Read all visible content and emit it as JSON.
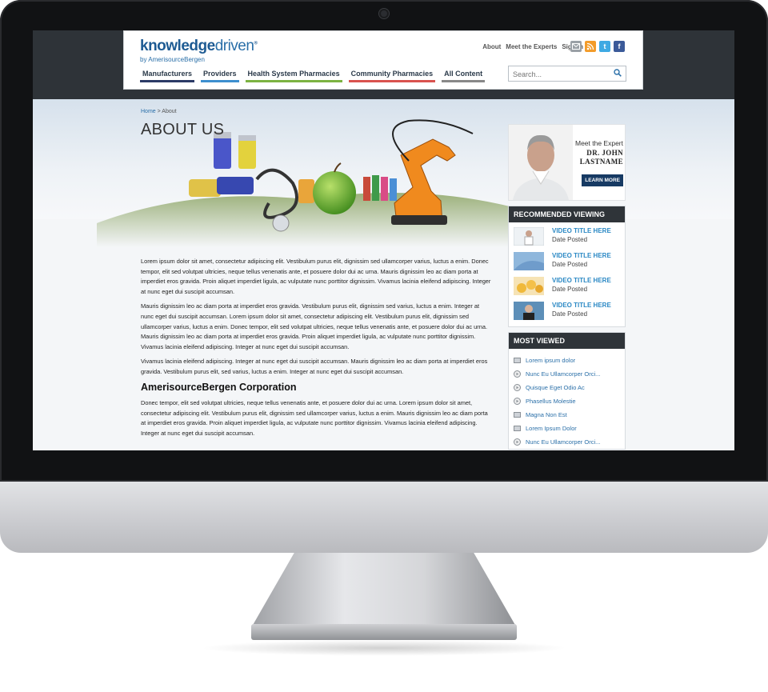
{
  "site": {
    "logo_main": "knowledge",
    "logo_main_thin": "driven",
    "logo_sub": "by AmerisourceBergen",
    "top_links": [
      "About",
      "Meet the Experts",
      "Sign In"
    ],
    "social_icons": [
      "mail-icon",
      "rss-icon",
      "twitter-icon",
      "facebook-icon"
    ],
    "nav": [
      {
        "label": "Manufacturers",
        "color": "#2b3a66"
      },
      {
        "label": "Providers",
        "color": "#3d8fcf"
      },
      {
        "label": "Health System Pharmacies",
        "color": "#7cb342"
      },
      {
        "label": "Community Pharmacies",
        "color": "#d9534f"
      },
      {
        "label": "All Content",
        "color": "#888888"
      }
    ],
    "search_placeholder": "Search..."
  },
  "breadcrumb": {
    "home": "Home",
    "separator": " > ",
    "current": "About"
  },
  "page_title": "ABOUT US",
  "paragraphs": [
    "Lorem ipsum dolor sit amet, consectetur adipiscing elit. Vestibulum purus elit, dignissim sed ullamcorper varius, luctus a enim. Donec tempor, elit sed volutpat ultricies, neque tellus venenatis ante, et posuere dolor dui ac urna. Mauris dignissim leo ac diam porta at imperdiet eros gravida. Proin aliquet imperdiet ligula, ac vulputate nunc porttitor dignissim. Vivamus lacinia eleifend adipiscing. Integer at nunc eget dui suscipit accumsan.",
    "Mauris dignissim leo ac diam porta at imperdiet eros gravida. Vestibulum purus elit, dignissim sed varius, luctus a enim. Integer at nunc eget dui suscipit accumsan. Lorem ipsum dolor sit amet, consectetur adipiscing elit. Vestibulum purus elit, dignissim sed ullamcorper varius, luctus a enim. Donec tempor, elit sed volutpat ultricies, neque tellus venenatis ante, et posuere dolor dui ac urna. Mauris dignissim leo ac diam porta at imperdiet eros gravida. Proin aliquet imperdiet ligula, ac vulputate nunc porttitor dignissim. Vivamus lacinia eleifend adipiscing. Integer at nunc eget dui suscipit accumsan.",
    "Vivamus lacinia eleifend adipiscing. Integer at nunc eget dui suscipit accumsan. Mauris dignissim leo ac diam porta at imperdiet eros gravida. Vestibulum purus elit, sed varius, luctus a enim. Integer at nunc eget dui suscipit accumsan."
  ],
  "section_heading": "AmerisourceBergen Corporation",
  "section_paragraph": "Donec tempor, elit sed volutpat ultricies, neque tellus venenatis ante, et posuere dolor dui ac urna. Lorem ipsum dolor sit amet, consectetur adipiscing elit. Vestibulum purus elit, dignissim sed ullamcorper varius, luctus a enim. Mauris dignissim leo ac diam porta at imperdiet eros gravida. Proin aliquet imperdiet ligula, ac vulputate nunc porttitor dignissim. Vivamus lacinia eleifend adipiscing. Integer at nunc eget dui suscipit accumsan.",
  "expert": {
    "meet_label": "Meet the Expert",
    "name_line1": "DR. JOHN",
    "name_line2": "LASTNAME",
    "button": "LEARN MORE"
  },
  "recommended": {
    "heading": "RECOMMENDED VIEWING",
    "items": [
      {
        "title": "VIDEO TITLE HERE",
        "date": "Date Posted"
      },
      {
        "title": "VIDEO TITLE HERE",
        "date": "Date Posted"
      },
      {
        "title": "VIDEO TITLE HERE",
        "date": "Date Posted"
      },
      {
        "title": "VIDEO TITLE HERE",
        "date": "Date Posted"
      }
    ]
  },
  "most_viewed": {
    "heading": "MOST VIEWED",
    "items": [
      {
        "label": "Lorem ipsum dolor",
        "icon": "document-icon"
      },
      {
        "label": "Nunc Eu Ullamcorper Orci...",
        "icon": "play-icon"
      },
      {
        "label": "Quisque Eget Odio Ac",
        "icon": "play-icon"
      },
      {
        "label": "Phasellus Molestie",
        "icon": "play-icon"
      },
      {
        "label": "Magna Non Est",
        "icon": "document-icon"
      },
      {
        "label": "Lorem Ipsum Dolor",
        "icon": "document-icon"
      },
      {
        "label": "Nunc Eu Ullamcorper Orci...",
        "icon": "play-icon"
      }
    ]
  }
}
